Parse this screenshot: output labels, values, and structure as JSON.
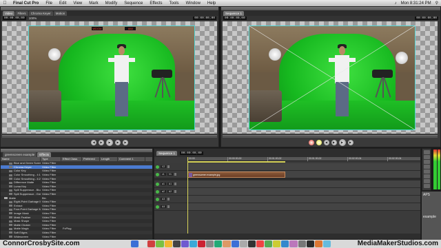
{
  "menubar": {
    "app_name": "Final Cut Pro",
    "items": [
      "File",
      "Edit",
      "View",
      "Mark",
      "Modify",
      "Sequence",
      "Effects",
      "Tools",
      "Window",
      "Help"
    ],
    "clock": "Mon 8:31:24 PM",
    "apple_icon": "apple-icon"
  },
  "viewer": {
    "tabs": [
      "Video",
      "Filters",
      "Chroma Keyer",
      "Motion"
    ],
    "timecode_left": "00:00:00;00",
    "timecode_right": "00:00:00;00",
    "zoom": "100%",
    "led_labels": [
      "WDGM",
      "888"
    ]
  },
  "canvas": {
    "tabs": [
      "Sequence 1"
    ],
    "timecode_left": "00:00:00;00",
    "timecode_right": "00:00:00;00"
  },
  "browser": {
    "tabs": [
      "greenscreen example",
      "Effects"
    ],
    "columns": [
      "Name",
      "Type",
      "Effect Class",
      "Preferred",
      "Length",
      "Comment 1"
    ],
    "rows": [
      {
        "name": "Blue and Green Screen",
        "type": "Video Filter",
        "class": "",
        "folder": false,
        "selected": false
      },
      {
        "name": "Chroma Keyer",
        "type": "Video Filter",
        "class": "",
        "folder": false,
        "selected": true
      },
      {
        "name": "Color Key",
        "type": "Video Filter",
        "class": "",
        "folder": false,
        "selected": false
      },
      {
        "name": "Color Smoothing - 4:1:1",
        "type": "Video Filter",
        "class": "",
        "folder": false,
        "selected": false
      },
      {
        "name": "Color Smoothing - 4:2:2",
        "type": "Video Filter",
        "class": "",
        "folder": false,
        "selected": false
      },
      {
        "name": "Difference Matte",
        "type": "Video Filter",
        "class": "",
        "folder": false,
        "selected": false
      },
      {
        "name": "Luma Key",
        "type": "Video Filter",
        "class": "",
        "folder": false,
        "selected": false
      },
      {
        "name": "Spill Suppressor - Blue",
        "type": "Video Filter",
        "class": "",
        "folder": false,
        "selected": false
      },
      {
        "name": "Spill Suppressor - Green",
        "type": "Video Filter",
        "class": "",
        "folder": false,
        "selected": false
      },
      {
        "name": "Matte",
        "type": "Bin",
        "class": "",
        "folder": true,
        "selected": false
      },
      {
        "name": "Eight-Point Garbage Matte",
        "type": "Video Filter",
        "class": "",
        "folder": false,
        "selected": false
      },
      {
        "name": "Extract",
        "type": "Video Filter",
        "class": "",
        "folder": false,
        "selected": false
      },
      {
        "name": "Four-Point Garbage Matte",
        "type": "Video Filter",
        "class": "",
        "folder": false,
        "selected": false
      },
      {
        "name": "Image Mask",
        "type": "Video Filter",
        "class": "",
        "folder": false,
        "selected": false
      },
      {
        "name": "Mask Feather",
        "type": "Video Filter",
        "class": "",
        "folder": false,
        "selected": false
      },
      {
        "name": "Mask Shape",
        "type": "Video Filter",
        "class": "",
        "folder": false,
        "selected": false
      },
      {
        "name": "Matte Choker",
        "type": "Video Filter",
        "class": "",
        "folder": false,
        "selected": false
      },
      {
        "name": "Matte Magic",
        "type": "Video Filter",
        "class": "FxPlug",
        "folder": false,
        "selected": false
      },
      {
        "name": "Soft Edges",
        "type": "Video Filter",
        "class": "",
        "folder": false,
        "selected": false
      },
      {
        "name": "Widescreen",
        "type": "Video Filter",
        "class": "",
        "folder": false,
        "selected": false
      }
    ]
  },
  "timeline": {
    "tab": "Sequence 1",
    "timecode": "00:00:00;00",
    "ruler_labels": [
      "00:00",
      "00:00:30;00",
      "00:01:00;02",
      "00:01:30;02",
      "00:02:00;04",
      "00:02:30;04"
    ],
    "tracks": [
      {
        "label": "V2",
        "target": ""
      },
      {
        "label": "V1",
        "target": "v1"
      },
      {
        "label": "A1",
        "target": "a1"
      },
      {
        "label": "A2",
        "target": "a2"
      },
      {
        "label": "A3",
        "target": ""
      },
      {
        "label": "A4",
        "target": ""
      }
    ],
    "clip_name": "greenscreen example.jpg"
  },
  "desktop_right": {
    "fragment": "APS",
    "label": "example"
  },
  "watermarks": {
    "left": "ConnorCrosbySite.com",
    "right": "MediaMakerStudios.com"
  },
  "colors": {
    "green_screen": "#22c02a",
    "overlay_cyan": "#52d6d6",
    "selection_blue": "#4b7bd0",
    "clip_brown": "#7a4a2e",
    "playhead_yellow": "#d8d55a"
  }
}
